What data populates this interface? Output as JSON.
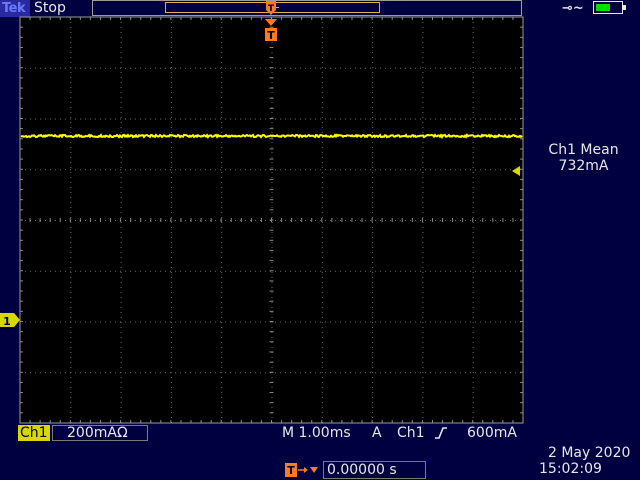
{
  "header": {
    "brand": "Tek",
    "acquisition_status": "Stop",
    "power_icon": "ac-plug-icon",
    "battery_icon": "battery-icon"
  },
  "trigger_markers": {
    "top_marker": "T",
    "screen_marker": "T"
  },
  "channel_marker": "1",
  "measurement": {
    "label": "Ch1 Mean",
    "value": "732mA"
  },
  "bottom": {
    "channel_label": "Ch1",
    "channel_scale": "200mA",
    "impedance_symbol": "Ω",
    "timebase": "M 1.00ms",
    "trigger_mode": "A",
    "trigger_source": "Ch1",
    "trigger_slope_icon": "rising-edge-icon",
    "trigger_level": "600mA",
    "trigger_position": "0.00000 s",
    "date": "2 May 2020",
    "time": "15:02:09"
  },
  "colors": {
    "background": "#000040",
    "grid_border": "#9a9a9a",
    "channel1": "#ffff00",
    "trigger": "#ff7a1a",
    "text": "#e8e8e8"
  }
}
